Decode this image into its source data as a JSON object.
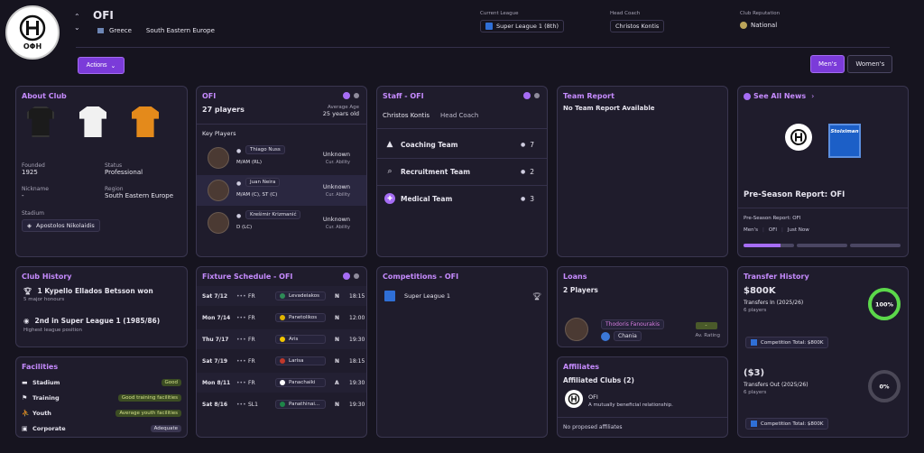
{
  "club": {
    "name": "OFI",
    "country": "Greece",
    "region": "South Eastern Europe",
    "logo_text": "ΟΦΗ"
  },
  "header": {
    "current_league_label": "Current League",
    "current_league": "Super League 1 (8th)",
    "head_coach_label": "Head Coach",
    "head_coach": "Christos Kontis",
    "reputation_label": "Club Reputation",
    "reputation": "National"
  },
  "actions_label": "Actions",
  "gender_tabs": [
    "Men's",
    "Women's"
  ],
  "about": {
    "title": "About Club",
    "founded_label": "Founded",
    "founded": "1925",
    "status_label": "Status",
    "status": "Professional",
    "nickname_label": "Nickname",
    "nickname": "-",
    "region_label": "Region",
    "region": "South Eastern Europe",
    "stadium_label": "Stadium",
    "stadium": "Apostolos Nikolaidis"
  },
  "squad": {
    "title": "OFI",
    "players": "27 players",
    "avg_age_label": "Average Age",
    "avg_age": "25 years old",
    "key_label": "Key Players",
    "rows": [
      {
        "name": "Thiago Nuss",
        "pos": "M/AM (RL)",
        "ability": "Unknown",
        "ability_label": "Cur. Ability"
      },
      {
        "name": "Juan Neira",
        "pos": "M/AM (C), ST (C)",
        "ability": "Unknown",
        "ability_label": "Cur. Ability"
      },
      {
        "name": "Krešimir Krizmanić",
        "pos": "D (LC)",
        "ability": "Unknown",
        "ability_label": "Cur. Ability"
      }
    ]
  },
  "staff": {
    "title": "Staff - OFI",
    "coach": "Christos Kontis",
    "coach_role": "Head Coach",
    "teams": [
      {
        "name": "Coaching Team",
        "count": "7",
        "icon": "whistle-icon"
      },
      {
        "name": "Recruitment Team",
        "count": "2",
        "icon": "magnifier-icon"
      },
      {
        "name": "Medical Team",
        "count": "3",
        "icon": "medical-plus-icon"
      }
    ]
  },
  "team_report": {
    "title": "Team Report",
    "text": "No Team Report Available"
  },
  "news": {
    "title": "See All News",
    "headline": "Pre-Season Report: OFI",
    "sub": "Pre-Season Report: OFI",
    "tags": [
      "Men's",
      "OFI",
      "Just Now"
    ],
    "sponsor": "Stoiximan"
  },
  "history": {
    "title": "Club History",
    "items": [
      {
        "main": "1 Kypello Ellados Betsson won",
        "sub": "5 major honours",
        "icon": "trophy-icon"
      },
      {
        "main": "2nd in Super League 1 (1985/86)",
        "sub": "Highest league position",
        "icon": "medal-icon"
      }
    ]
  },
  "fixtures": {
    "title": "Fixture Schedule - OFI",
    "rows": [
      {
        "date": "Sat 7/12",
        "comp": "FR",
        "opp": "Levadeiakos",
        "ha": "N",
        "time": "18:15",
        "color": "#2e8b57"
      },
      {
        "date": "Mon 7/14",
        "comp": "FR",
        "opp": "Panetolikos",
        "ha": "N",
        "time": "12:00",
        "color": "#e0b400"
      },
      {
        "date": "Thu 7/17",
        "comp": "FR",
        "opp": "Aris",
        "ha": "N",
        "time": "19:30",
        "color": "#f2c500"
      },
      {
        "date": "Sat 7/19",
        "comp": "FR",
        "opp": "Larisa",
        "ha": "N",
        "time": "18:15",
        "color": "#c0392b"
      },
      {
        "date": "Mon 8/11",
        "comp": "FR",
        "opp": "Panachaiki",
        "ha": "A",
        "time": "19:30",
        "color": "#ffffff"
      },
      {
        "date": "Sat 8/16",
        "comp": "SL1",
        "opp": "Panathinai...",
        "ha": "N",
        "time": "19:30",
        "color": "#1e8449"
      }
    ]
  },
  "competitions": {
    "title": "Competitions - OFI",
    "items": [
      {
        "name": "Super League 1"
      }
    ]
  },
  "loans": {
    "title": "Loans",
    "count": "2 Players",
    "player": "Thodoris Fanourakis",
    "club": "Chania",
    "rating": "-",
    "rating_label": "Av. Rating"
  },
  "affiliates": {
    "title": "Affiliates",
    "clubs": "Affiliated Clubs (2)",
    "club": "OFI",
    "desc": "A mutually beneficial relationship.",
    "none": "No proposed affiliates"
  },
  "facilities": {
    "title": "Facilities",
    "items": [
      {
        "name": "Stadium",
        "value": "Good",
        "green": true
      },
      {
        "name": "Training",
        "value": "Good training facilities",
        "green": true
      },
      {
        "name": "Youth",
        "value": "Average youth facilities",
        "green": true
      },
      {
        "name": "Corporate",
        "value": "Adequate",
        "green": false
      }
    ]
  },
  "transfer": {
    "title": "Transfer History",
    "in_amount": "$800K",
    "in_label": "Transfers In (2025/26)",
    "in_players": "6 players",
    "in_pct": "100%",
    "in_total": "Competition Total: $800K",
    "in_fill": 1.0,
    "out_amount": "($3)",
    "out_label": "Transfers Out (2025/26)",
    "out_players": "6 players",
    "out_pct": "0%",
    "out_total": "Competition Total: $800K",
    "out_fill": 0.0
  },
  "colors": {
    "accent": "#a66df5",
    "green": "#5bd84a",
    "bg": "#16141f",
    "card": "#1f1c2c"
  }
}
